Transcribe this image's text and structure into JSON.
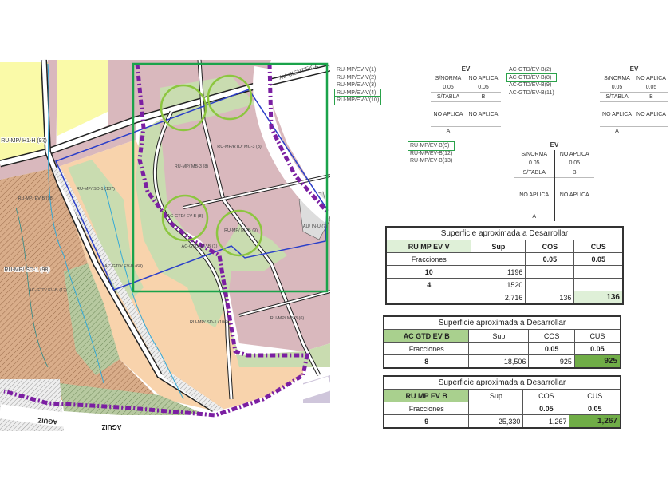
{
  "map": {
    "street_top": "AV. CIENTIFICA",
    "street_bottom": "AGUIZ",
    "zone_labels": [
      "RU-MP/ MB-3 (8)",
      "RU-MP/RTD/ MC-3 (3)",
      "AC-GTD/ EV-B (8)",
      "RU-MP/ EV-B (9)",
      "AC-GTD/ EV-B (1)",
      "RU-MP/ SD-1 (137)",
      "RU-MP/ EV-B (98)",
      "RU-MP/ SD-1 (98)",
      "AC-GTD/ EV-B (12)",
      "RU-MP/ H1-H (97)",
      "RU-MP/ SD-1 (106)",
      "RU-MP/ MB-3 (6)",
      "AC-GTD/ EV-B (68)",
      "AU/ IN-U (7)"
    ],
    "colors": {
      "pink": "#d9b8bd",
      "tan": "#f8d3ac",
      "green": "#c9dcb0",
      "brown": "#d9ad8a",
      "yellow": "#fafaa8",
      "purple": "#7b1fa2",
      "frame": "#1aa34a",
      "circle": "#8cc63f",
      "blue": "#2b3fc9"
    }
  },
  "lists": [
    {
      "items": [
        "RU-MP/EV-V(1)",
        "RU-MP/EV-V(2)",
        "RU-MP/EV-V(3)",
        "RU-MP/EV-V(4)",
        "RU-MP/EV-V(10)"
      ],
      "highlight": [
        3,
        4
      ]
    },
    {
      "items": [
        "AC-GTD/EV-B(2)",
        "AC-GTD/EV-B(8)",
        "AC-GTD/EV-B(9)",
        "AC-GTD/EV-B(11)"
      ],
      "highlight": [
        1
      ]
    },
    {
      "items": [
        "RU-MP/EV-B(9)",
        "RU-MP/EV-B(12)",
        "RU-MP/EV-B(13)"
      ],
      "highlight": [
        0
      ]
    }
  ],
  "ev_tables": [
    {
      "title": "EV",
      "r1": [
        "S/NORMA",
        "NO APLICA"
      ],
      "r2": [
        "0.05",
        "0.05"
      ],
      "r3": [
        "S/TABLA",
        "B"
      ],
      "r4": [
        "NO APLICA",
        "NO APLICA"
      ],
      "r5": [
        "A",
        ""
      ]
    },
    {
      "title": "EV",
      "r1": [
        "S/NORMA",
        "NO APLICA"
      ],
      "r2": [
        "0.05",
        "0.05"
      ],
      "r3": [
        "S/TABLA",
        "B"
      ],
      "r4": [
        "NO APLICA",
        "NO APLICA"
      ],
      "r5": [
        "A",
        ""
      ]
    },
    {
      "title": "EV",
      "r1": [
        "S/NORMA",
        "NO APLICA"
      ],
      "r2": [
        "0.05",
        "0.05"
      ],
      "r3": [
        "S/TABLA",
        "B"
      ],
      "r4": [
        "NO APLICA",
        "NO APLICA"
      ],
      "r5": [
        "A",
        ""
      ]
    }
  ],
  "tables": [
    {
      "title": "Superficie aproximada a Desarrollar",
      "headers": [
        "RU MP EV V",
        "Sup",
        "COS",
        "CUS"
      ],
      "rows": [
        [
          "Fracciones",
          "",
          "0.05",
          "0.05"
        ],
        [
          "10",
          "1196",
          "",
          ""
        ],
        [
          "4",
          "1520",
          "",
          ""
        ],
        [
          "",
          "2,716",
          "136",
          "136"
        ]
      ]
    },
    {
      "title": "Superficie aproximada a Desarrollar",
      "headers": [
        "AC GTD EV B",
        "Sup",
        "COS",
        "CUS"
      ],
      "rows": [
        [
          "Fracciones",
          "",
          "0.05",
          "0.05"
        ],
        [
          "8",
          "18,506",
          "925",
          "925"
        ]
      ]
    },
    {
      "title": "Superficie aproximada a Desarrollar",
      "headers": [
        "RU MP EV B",
        "Sup",
        "COS",
        "CUS"
      ],
      "rows": [
        [
          "Fracciones",
          "",
          "0.05",
          "0.05"
        ],
        [
          "9",
          "25,330",
          "1,267",
          "1,267"
        ]
      ]
    }
  ]
}
